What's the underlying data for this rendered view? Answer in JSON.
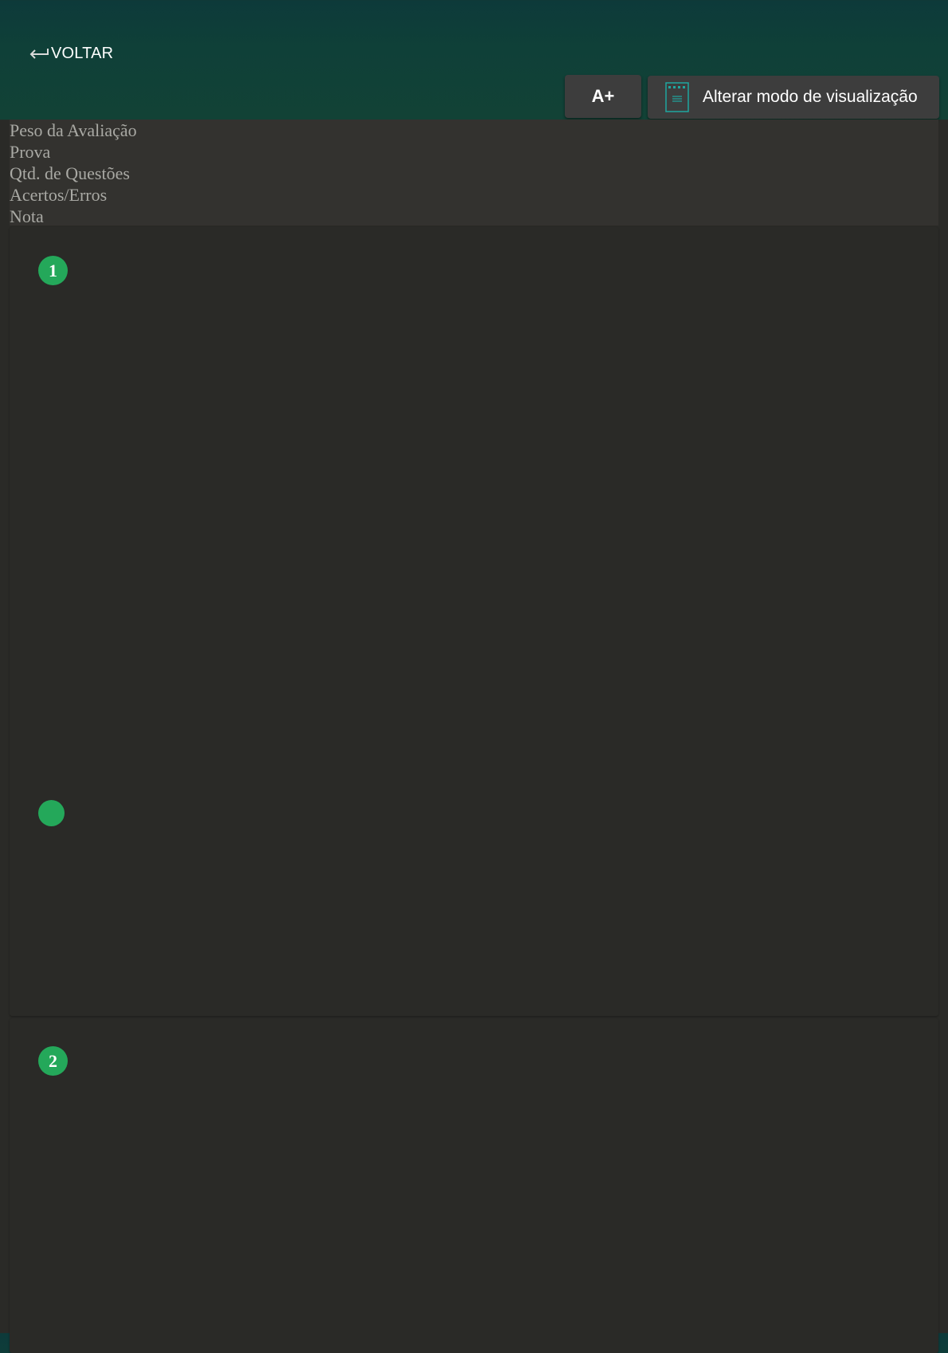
{
  "header": {
    "back_label": "VOLTAR",
    "font_button_label": "A+",
    "view_mode_label": "Alterar modo de visualização"
  },
  "info": {
    "lines": [
      "Peso da Avaliação",
      "Prova",
      "Qtd. de Questões",
      "Acertos/Erros",
      "Nota"
    ]
  },
  "questions": [
    {
      "number": "1"
    },
    {
      "number": "2"
    }
  ],
  "colors": {
    "header_bg": "#0f4038",
    "panel_bg": "#2a2a27",
    "badge": "#24a85a",
    "button_bg": "#3d3d3d",
    "icon_accent": "#1fa7a0"
  },
  "icons": {
    "back": "return-arrow-icon",
    "view_mode": "document-icon"
  }
}
